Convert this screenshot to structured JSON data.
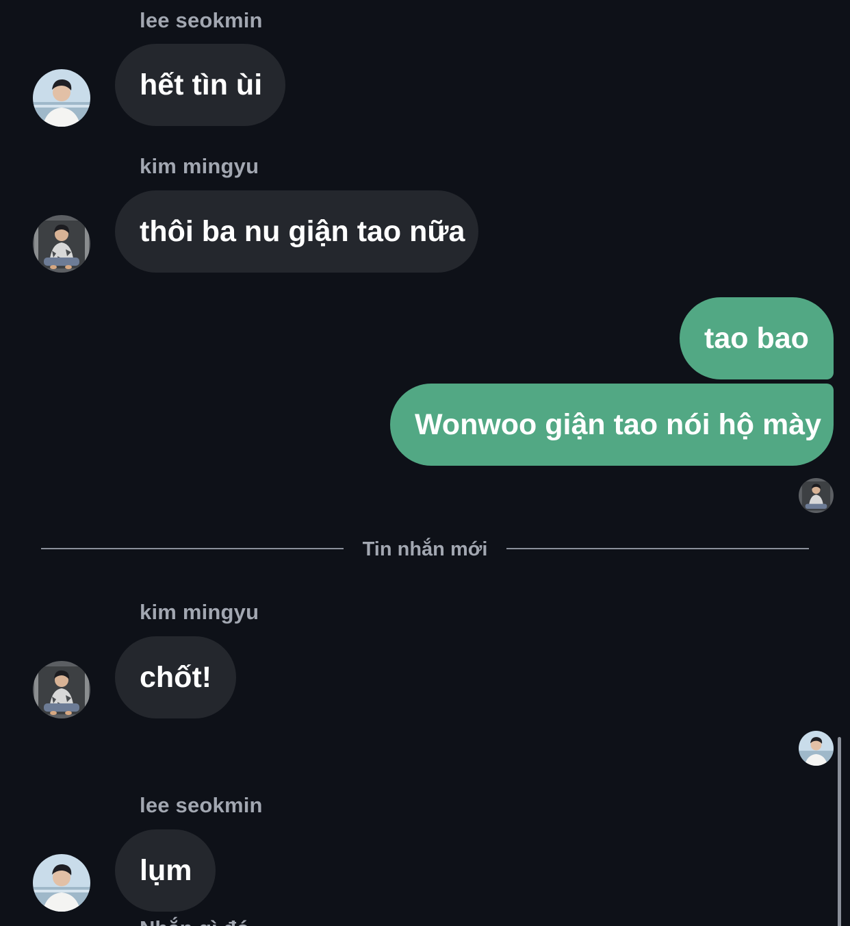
{
  "conversation": {
    "messages": [
      {
        "sender": "lee seokmin",
        "text": "hết tìn ùi",
        "avatar_icon": "avatar-seokmin"
      },
      {
        "sender": "kim mingyu",
        "text": "thôi ba nu giận tao nữa",
        "avatar_icon": "avatar-mingyu"
      },
      {
        "sender": "",
        "text": "tao bao",
        "outgoing": true
      },
      {
        "sender": "",
        "text": "Wonwoo giận tao nói hộ mày",
        "outgoing": true
      },
      {
        "sender": "kim mingyu",
        "text": "chốt!",
        "avatar_icon": "avatar-mingyu"
      },
      {
        "sender": "lee seokmin",
        "text": "lụm",
        "avatar_icon": "avatar-seokmin"
      }
    ],
    "new_messages_divider": "Tin nhắn mới",
    "read_receipts": [
      "avatar-mingyu",
      "avatar-seokmin"
    ],
    "next_sender_partial": "Nhắn gì đó…"
  },
  "colors": {
    "background": "#0e1118",
    "incoming_bubble": "#24272d",
    "outgoing_bubble": "#52a884",
    "sender_text": "#a2a7b1",
    "message_text": "#ffffff"
  }
}
